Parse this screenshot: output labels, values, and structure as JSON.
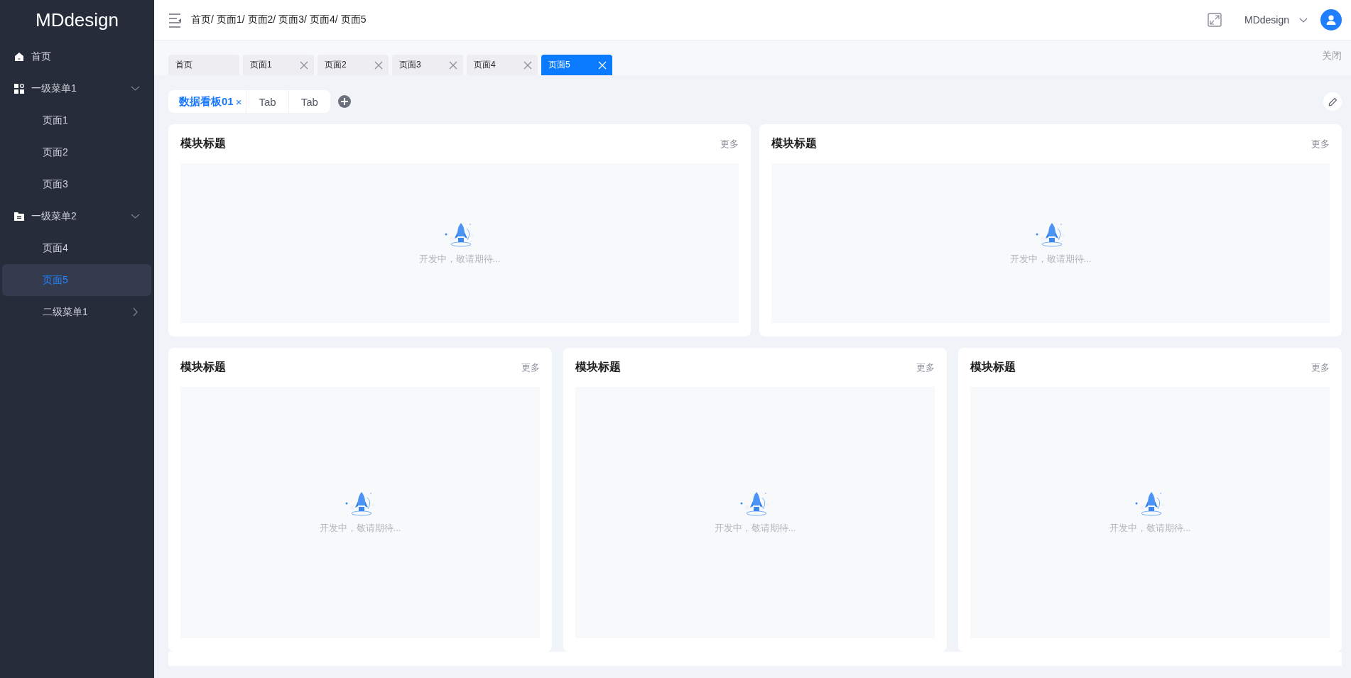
{
  "sidebar": {
    "logo": "MDdesign",
    "items": [
      {
        "label": "首页",
        "kind": "page",
        "selected": false
      },
      {
        "label": "一级菜单1",
        "kind": "group",
        "expanded": true,
        "children": [
          {
            "label": "页面1",
            "kind": "page",
            "selected": false
          },
          {
            "label": "页面2",
            "kind": "page",
            "selected": false
          },
          {
            "label": "页面3",
            "kind": "page",
            "selected": false
          }
        ]
      },
      {
        "label": "一级菜单2",
        "kind": "group",
        "expanded": true,
        "children": [
          {
            "label": "页面4",
            "kind": "page",
            "selected": false
          },
          {
            "label": "页面5",
            "kind": "page",
            "selected": true
          },
          {
            "label": "二级菜单1",
            "kind": "group",
            "expanded": false
          }
        ]
      }
    ]
  },
  "header": {
    "breadcrumb": [
      "首页/",
      "页面1/",
      "页面2/",
      "页面3/",
      "页面4/",
      "页面5"
    ],
    "user": "MDdesign"
  },
  "page_tabs": {
    "tabs": [
      {
        "label": "首页",
        "closable": false,
        "selected": false
      },
      {
        "label": "页面1",
        "closable": true,
        "selected": false
      },
      {
        "label": "页面2",
        "closable": true,
        "selected": false
      },
      {
        "label": "页面3",
        "closable": true,
        "selected": false
      },
      {
        "label": "页面4",
        "closable": true,
        "selected": false
      },
      {
        "label": "页面5",
        "closable": true,
        "selected": true
      }
    ],
    "close_all": "关闭"
  },
  "board_tabs": [
    {
      "label": "数据看板01",
      "close": "×",
      "selected": true
    },
    {
      "label": "Tab",
      "selected": false
    },
    {
      "label": "Tab",
      "selected": false
    }
  ],
  "card_rows": [
    [
      {
        "title": "模块标题",
        "more": "更多",
        "empty_text": "开发中，敬请期待..."
      },
      {
        "title": "模块标题",
        "more": "更多",
        "empty_text": "开发中，敬请期待..."
      }
    ],
    [
      {
        "title": "模块标题",
        "more": "更多",
        "empty_text": "开发中，敬请期待..."
      },
      {
        "title": "模块标题",
        "more": "更多",
        "empty_text": "开发中，敬请期待..."
      },
      {
        "title": "模块标题",
        "more": "更多",
        "empty_text": "开发中，敬请期待..."
      }
    ]
  ]
}
